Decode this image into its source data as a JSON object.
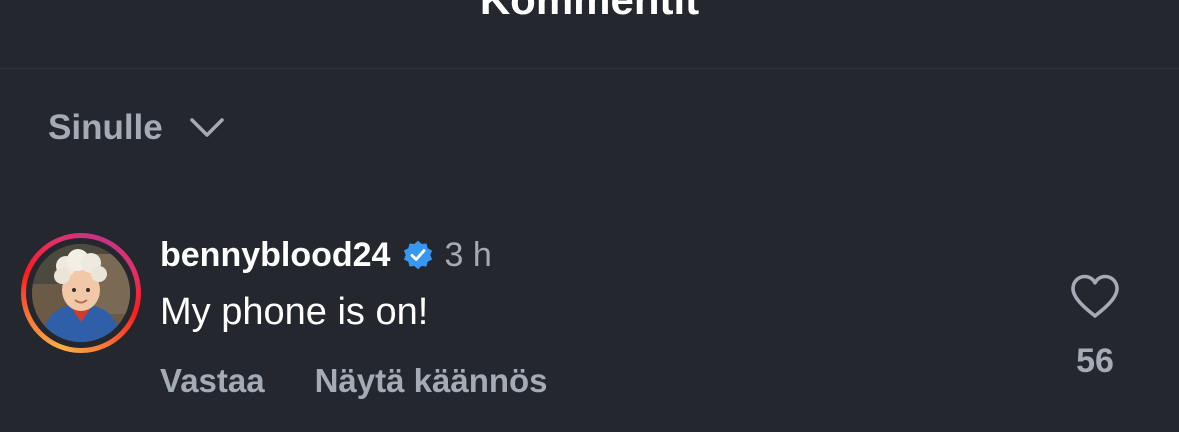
{
  "header": {
    "title": "Kommentit"
  },
  "sort": {
    "label": "Sinulle",
    "icon": "chevron-down-icon"
  },
  "comment": {
    "username": "bennyblood24",
    "verified": true,
    "verified_color": "#3897f0",
    "time": "3 h",
    "text": "My phone is on!",
    "actions": {
      "reply": "Vastaa",
      "translate": "Näytä käännös"
    },
    "likes": "56",
    "avatar": "avatar-photo",
    "avatar_ring_colors": [
      "#fcaf45",
      "#f77737",
      "#fd1d1d",
      "#e1306c",
      "#c13584"
    ]
  },
  "colors": {
    "background": "#24272e",
    "primary_text": "#ffffff",
    "secondary_text": "#a5abb5"
  }
}
